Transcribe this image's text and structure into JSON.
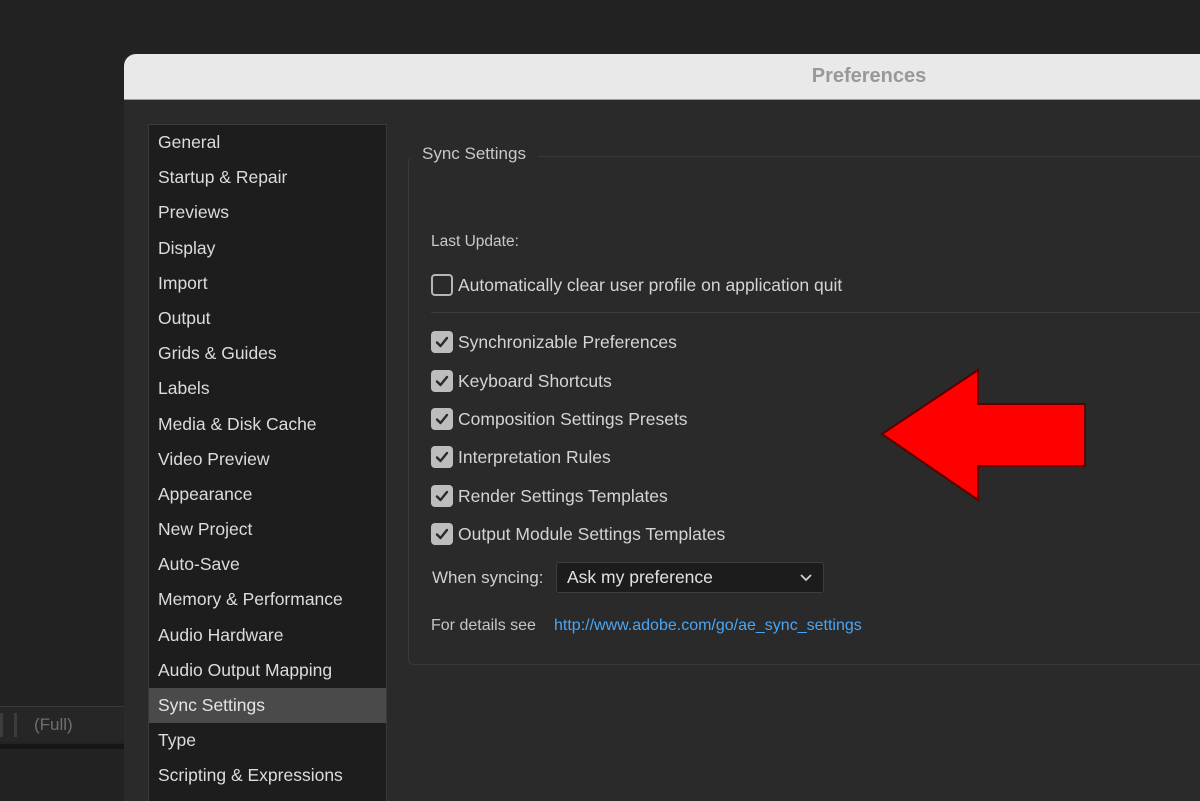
{
  "background": {
    "view_label": "(Full)"
  },
  "dialog": {
    "title": "Preferences"
  },
  "nav": {
    "items": [
      {
        "label": "General"
      },
      {
        "label": "Startup & Repair"
      },
      {
        "label": "Previews"
      },
      {
        "label": "Display"
      },
      {
        "label": "Import"
      },
      {
        "label": "Output"
      },
      {
        "label": "Grids & Guides"
      },
      {
        "label": "Labels"
      },
      {
        "label": "Media & Disk Cache"
      },
      {
        "label": "Video Preview"
      },
      {
        "label": "Appearance"
      },
      {
        "label": "New Project"
      },
      {
        "label": "Auto-Save"
      },
      {
        "label": "Memory & Performance"
      },
      {
        "label": "Audio Hardware"
      },
      {
        "label": "Audio Output Mapping"
      },
      {
        "label": "Sync Settings"
      },
      {
        "label": "Type"
      },
      {
        "label": "Scripting & Expressions"
      }
    ],
    "selected": "Sync Settings"
  },
  "sync": {
    "group_title": "Sync Settings",
    "last_update_label": "Last Update:",
    "auto_clear": {
      "label": "Automatically clear user profile on application quit",
      "checked": false
    },
    "options": [
      {
        "label": "Synchronizable Preferences",
        "checked": true
      },
      {
        "label": "Keyboard Shortcuts",
        "checked": true
      },
      {
        "label": "Composition Settings Presets",
        "checked": true
      },
      {
        "label": "Interpretation Rules",
        "checked": true
      },
      {
        "label": "Render Settings Templates",
        "checked": true
      },
      {
        "label": "Output Module Settings Templates",
        "checked": true
      }
    ],
    "when_syncing_label": "When syncing:",
    "when_syncing_value": "Ask my preference",
    "details_label": "For details see",
    "details_link": "http://www.adobe.com/go/ae_sync_settings"
  },
  "colors": {
    "annotation_arrow": "#ff0000",
    "link": "#4aa6f5",
    "selected_nav": "#4a4a4a"
  }
}
